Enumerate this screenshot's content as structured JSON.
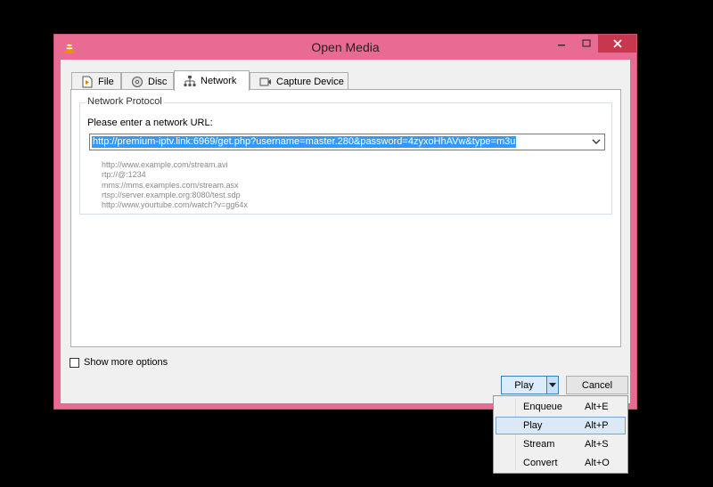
{
  "window": {
    "title": "Open Media"
  },
  "tabs": [
    {
      "label": "File"
    },
    {
      "label": "Disc"
    },
    {
      "label": "Network"
    },
    {
      "label": "Capture Device"
    }
  ],
  "network": {
    "group_title": "Network Protocol",
    "url_label": "Please enter a network URL:",
    "url_value": "http://premium-iptv.link:6969/get.php?username=master.280&password=4zyxoHhAVw&type=m3u",
    "examples": [
      "http://www.example.com/stream.avi",
      "rtp://@:1234",
      "mms://mms.examples.com/stream.asx",
      "rtsp://server.example.org:8080/test.sdp",
      "http://www.yourtube.com/watch?v=gg64x"
    ]
  },
  "options": {
    "show_more": "Show more options"
  },
  "buttons": {
    "play": "Play",
    "cancel": "Cancel"
  },
  "menu": [
    {
      "label": "Enqueue",
      "shortcut": "Alt+E"
    },
    {
      "label": "Play",
      "shortcut": "Alt+P"
    },
    {
      "label": "Stream",
      "shortcut": "Alt+S"
    },
    {
      "label": "Convert",
      "shortcut": "Alt+O"
    }
  ],
  "colors": {
    "frame": "#e96b93",
    "close": "#c7384e",
    "selection": "#3399ff"
  }
}
